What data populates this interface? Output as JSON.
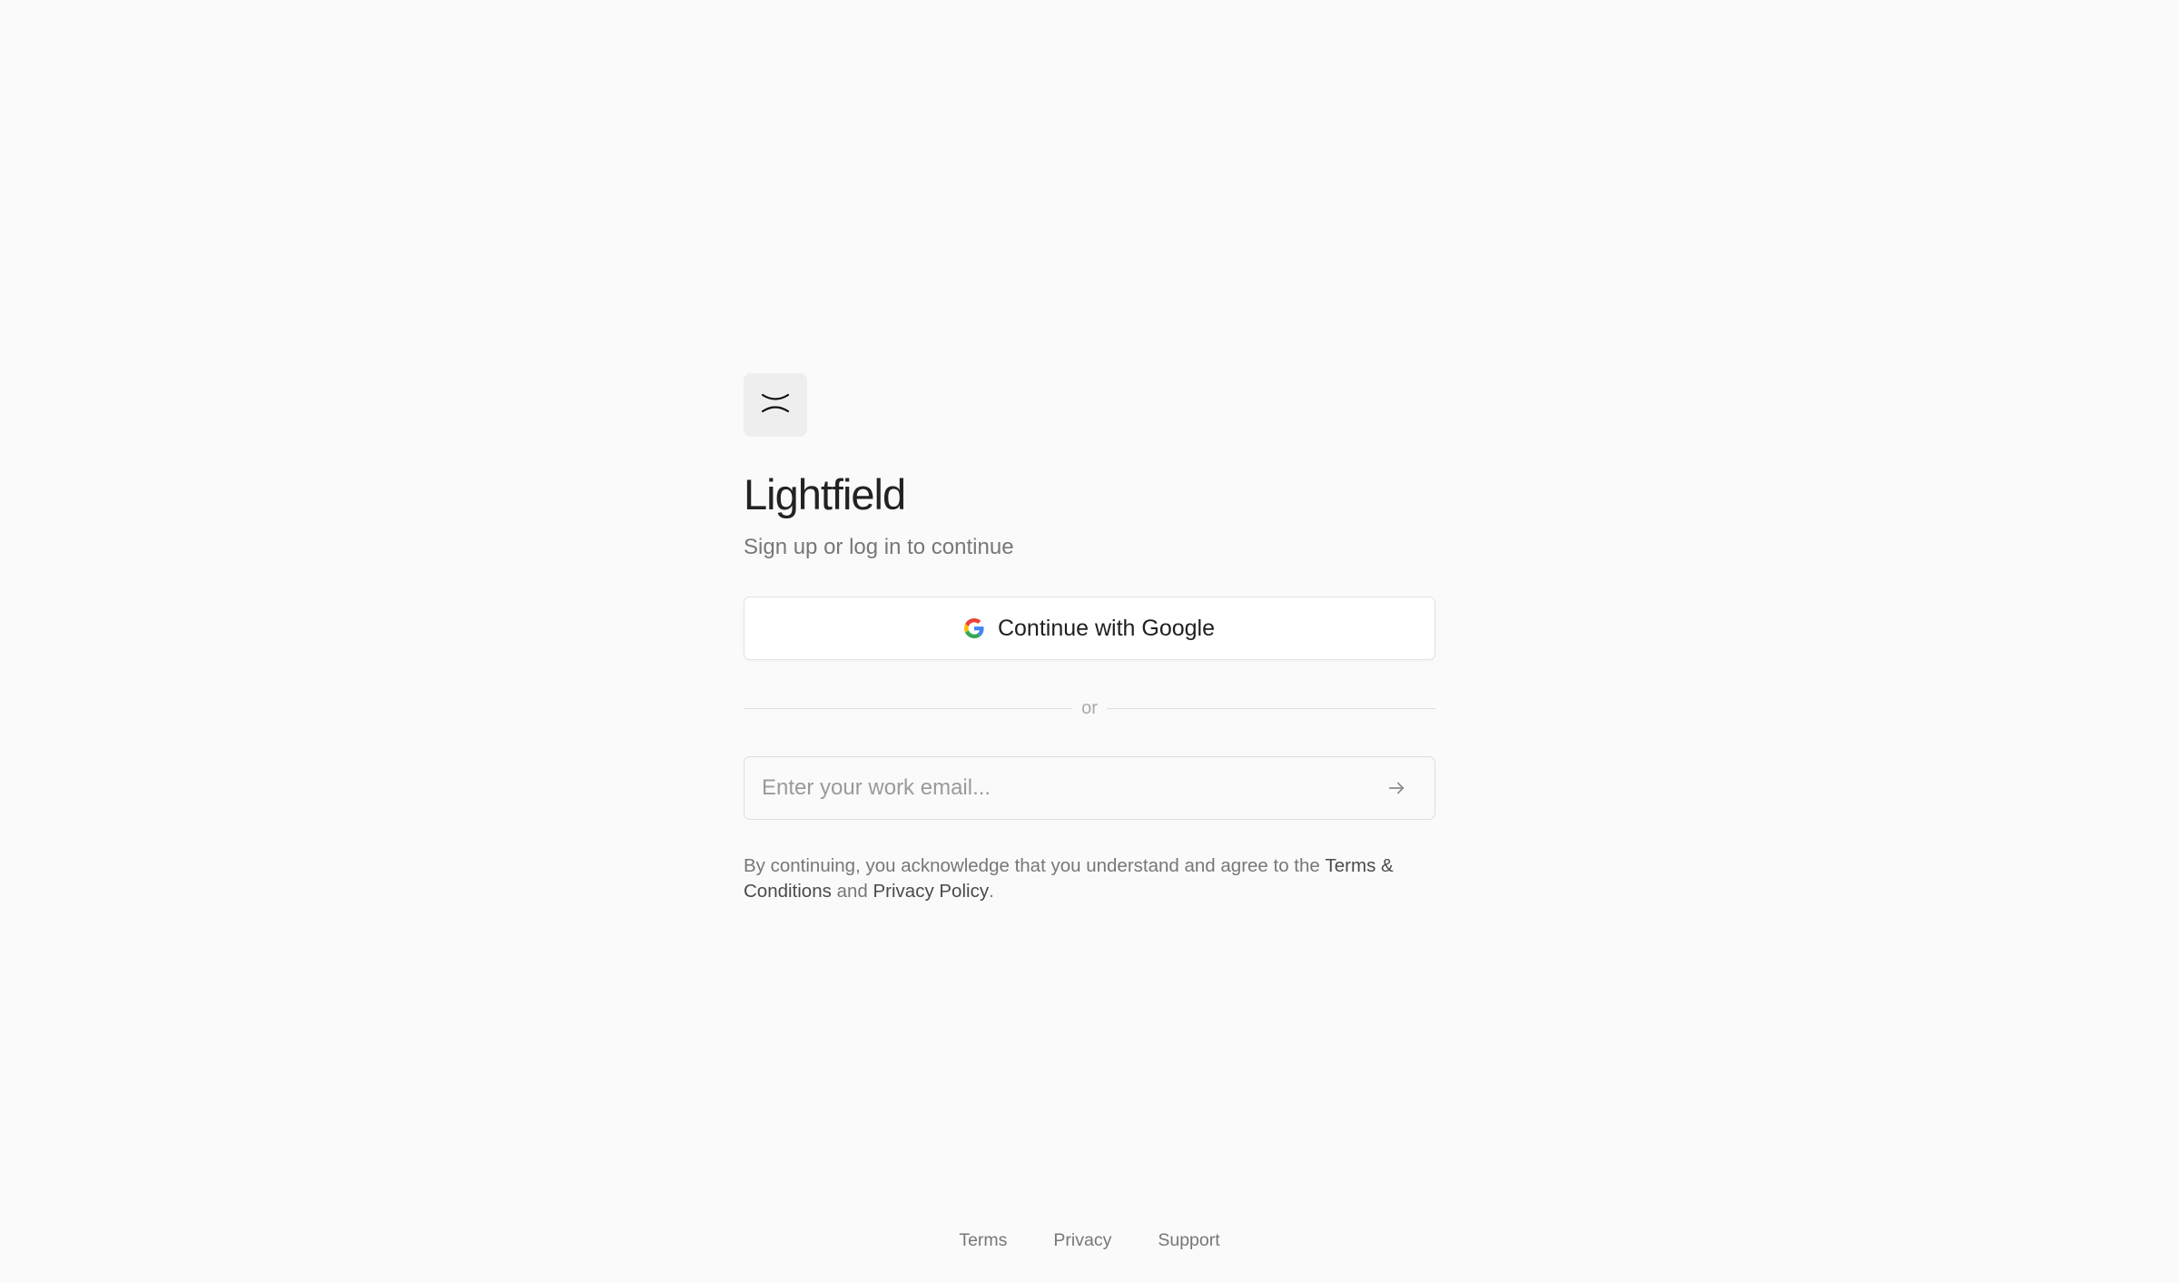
{
  "app": {
    "name": "Lightfield",
    "subtitle": "Sign up or log in to continue",
    "logo_icon": "lightfield-logo-icon"
  },
  "auth": {
    "google_button_label": "Continue with Google",
    "google_icon": "google-g-icon",
    "divider_label": "or",
    "email_placeholder": "Enter your work email...",
    "email_value": "",
    "submit_icon": "arrow-right-icon"
  },
  "legal": {
    "prefix": "By continuing, you acknowledge that you understand and agree to the ",
    "terms_link": "Terms & Conditions",
    "middle": " and ",
    "privacy_link": "Privacy Policy",
    "suffix": "."
  },
  "footer": {
    "links": [
      "Terms",
      "Privacy",
      "Support"
    ]
  },
  "colors": {
    "background": "#fafafa",
    "text_primary": "#222222",
    "text_secondary": "#777777",
    "border": "#dedede"
  }
}
